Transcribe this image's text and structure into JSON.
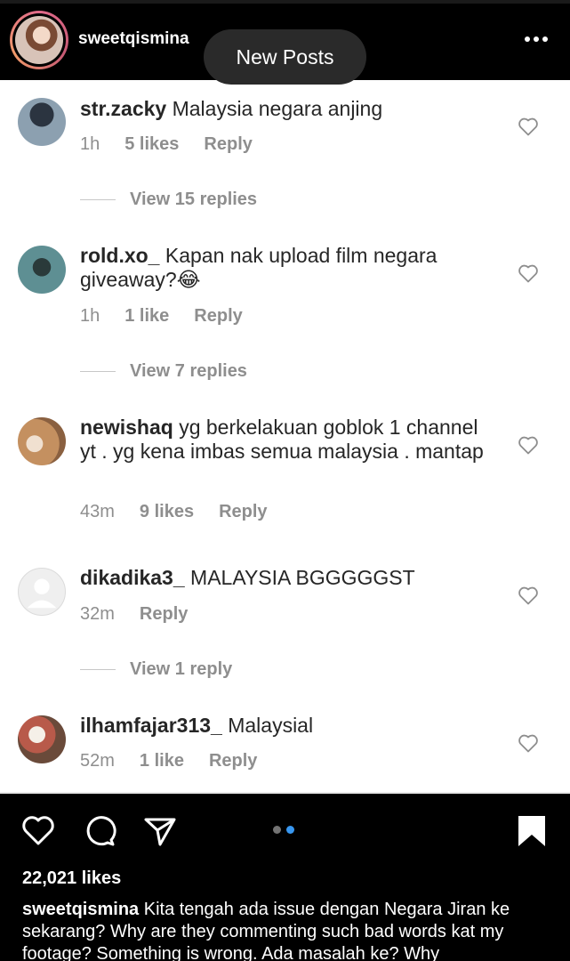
{
  "header": {
    "username": "sweetqismina",
    "new_posts_label": "New Posts",
    "more_icon": "more-horizontal-icon"
  },
  "comments": [
    {
      "username": "str.zacky",
      "text": "Malaysia negara anjing",
      "time": "1h",
      "likes": "5 likes",
      "reply": "Reply",
      "view_replies": "View 15 replies",
      "avatar_color": "#5a6a7a"
    },
    {
      "username": "rold.xo_",
      "text": "Kapan nak upload film negara giveaway?😂",
      "time": "1h",
      "likes": "1 like",
      "reply": "Reply",
      "view_replies": "View 7 replies",
      "avatar_color": "#3d6b6e"
    },
    {
      "username": "newishaq",
      "text": "yg berkelakuan goblok  1 channel yt . yg kena imbas semua malaysia . mantap",
      "time": "43m",
      "likes": "9 likes",
      "reply": "Reply",
      "view_replies": "",
      "avatar_color": "#b98a5e"
    },
    {
      "username": "dikadika3_",
      "text": "MALAYSIA BGGGGGST",
      "time": "32m",
      "likes": "",
      "reply": "Reply",
      "view_replies": "View 1 reply",
      "avatar_color": "#dbdbdb"
    },
    {
      "username": "ilhamfajar313_",
      "text": "Malaysial",
      "time": "52m",
      "likes": "1 like",
      "reply": "Reply",
      "view_replies": "",
      "avatar_color": "#8a5a4a"
    }
  ],
  "footer": {
    "likes_count": "22,021 likes",
    "caption_username": "sweetqismina",
    "caption_text": "Kita tengah ada issue dengan Negara Jiran ke sekarang? Why are they commenting such bad words kat my footage? Something is wrong. Ada masalah ke? Why",
    "icons": [
      "heart-icon",
      "comment-icon",
      "share-icon",
      "bookmark-icon"
    ],
    "carousel_active_color": "#3897f0",
    "carousel_inactive_color": "#737373"
  }
}
